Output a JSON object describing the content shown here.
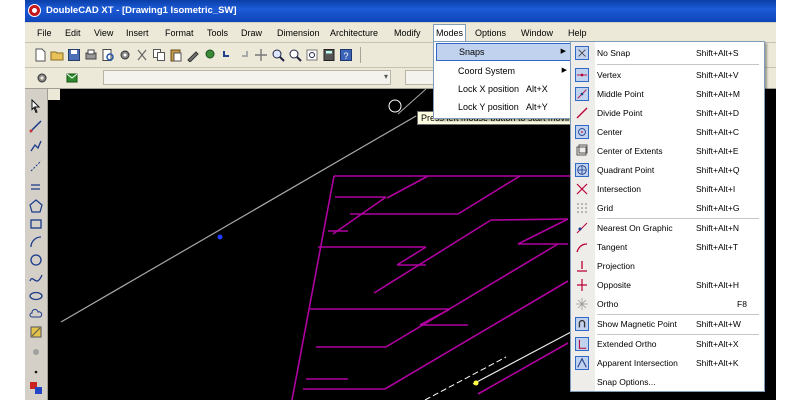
{
  "window": {
    "title": "DoubleCAD XT - [Drawing1 Isometric_SW]"
  },
  "menubar": {
    "items": [
      {
        "label": "File"
      },
      {
        "label": "Edit"
      },
      {
        "label": "View"
      },
      {
        "label": "Insert"
      },
      {
        "label": "Format"
      },
      {
        "label": "Tools"
      },
      {
        "label": "Draw"
      },
      {
        "label": "Dimension"
      },
      {
        "label": "Architecture"
      },
      {
        "label": "Modify"
      },
      {
        "label": "Modes"
      },
      {
        "label": "Options"
      },
      {
        "label": "Window"
      },
      {
        "label": "Help"
      }
    ],
    "active": "Modes"
  },
  "canvas": {
    "tooltip": "Press left mouse button to start moving",
    "background": "#000000",
    "line_color": "#b4009e"
  },
  "modes_menu": {
    "items": [
      {
        "label": "Snaps",
        "shortcut": "",
        "submenu": true,
        "highlighted": true
      },
      {
        "label": "Coord System",
        "shortcut": "",
        "submenu": true
      },
      {
        "label": "Lock X position",
        "shortcut": "Alt+X"
      },
      {
        "label": "Lock Y position",
        "shortcut": "Alt+Y"
      }
    ]
  },
  "snaps_menu": {
    "items": [
      {
        "label": "No Snap",
        "shortcut": "Shift+Alt+S",
        "icon": "no-snap-icon"
      },
      {
        "label": "Vertex",
        "shortcut": "Shift+Alt+V",
        "icon": "vertex-snap-icon"
      },
      {
        "label": "Middle Point",
        "shortcut": "Shift+Alt+M",
        "icon": "middle-point-icon"
      },
      {
        "label": "Divide Point",
        "shortcut": "Shift+Alt+D",
        "icon": "divide-point-icon"
      },
      {
        "label": "Center",
        "shortcut": "Shift+Alt+C",
        "icon": "center-icon"
      },
      {
        "label": "Center of Extents",
        "shortcut": "Shift+Alt+E",
        "icon": "center-extents-icon"
      },
      {
        "label": "Quadrant Point",
        "shortcut": "Shift+Alt+Q",
        "icon": "quadrant-point-icon"
      },
      {
        "label": "Intersection",
        "shortcut": "Shift+Alt+I",
        "icon": "intersection-icon"
      },
      {
        "label": "Grid",
        "shortcut": "Shift+Alt+G",
        "icon": "grid-icon"
      },
      {
        "label": "Nearest On Graphic",
        "shortcut": "Shift+Alt+N",
        "icon": "nearest-icon"
      },
      {
        "label": "Tangent",
        "shortcut": "Shift+Alt+T",
        "icon": "tangent-icon"
      },
      {
        "label": "Projection",
        "shortcut": "",
        "icon": "projection-icon"
      },
      {
        "label": "Opposite",
        "shortcut": "Shift+Alt+H",
        "icon": "opposite-icon"
      },
      {
        "label": "Ortho",
        "shortcut": "F8",
        "icon": "ortho-icon"
      },
      {
        "label": "Show Magnetic Point",
        "shortcut": "Shift+Alt+W",
        "icon": "magnetic-point-icon"
      },
      {
        "label": "Extended Ortho",
        "shortcut": "Shift+Alt+X",
        "icon": "extended-ortho-icon"
      },
      {
        "label": "Apparent Intersection",
        "shortcut": "Shift+Alt+K",
        "icon": "apparent-intersection-icon"
      },
      {
        "label": "Snap Options...",
        "shortcut": "",
        "icon": ""
      }
    ]
  }
}
